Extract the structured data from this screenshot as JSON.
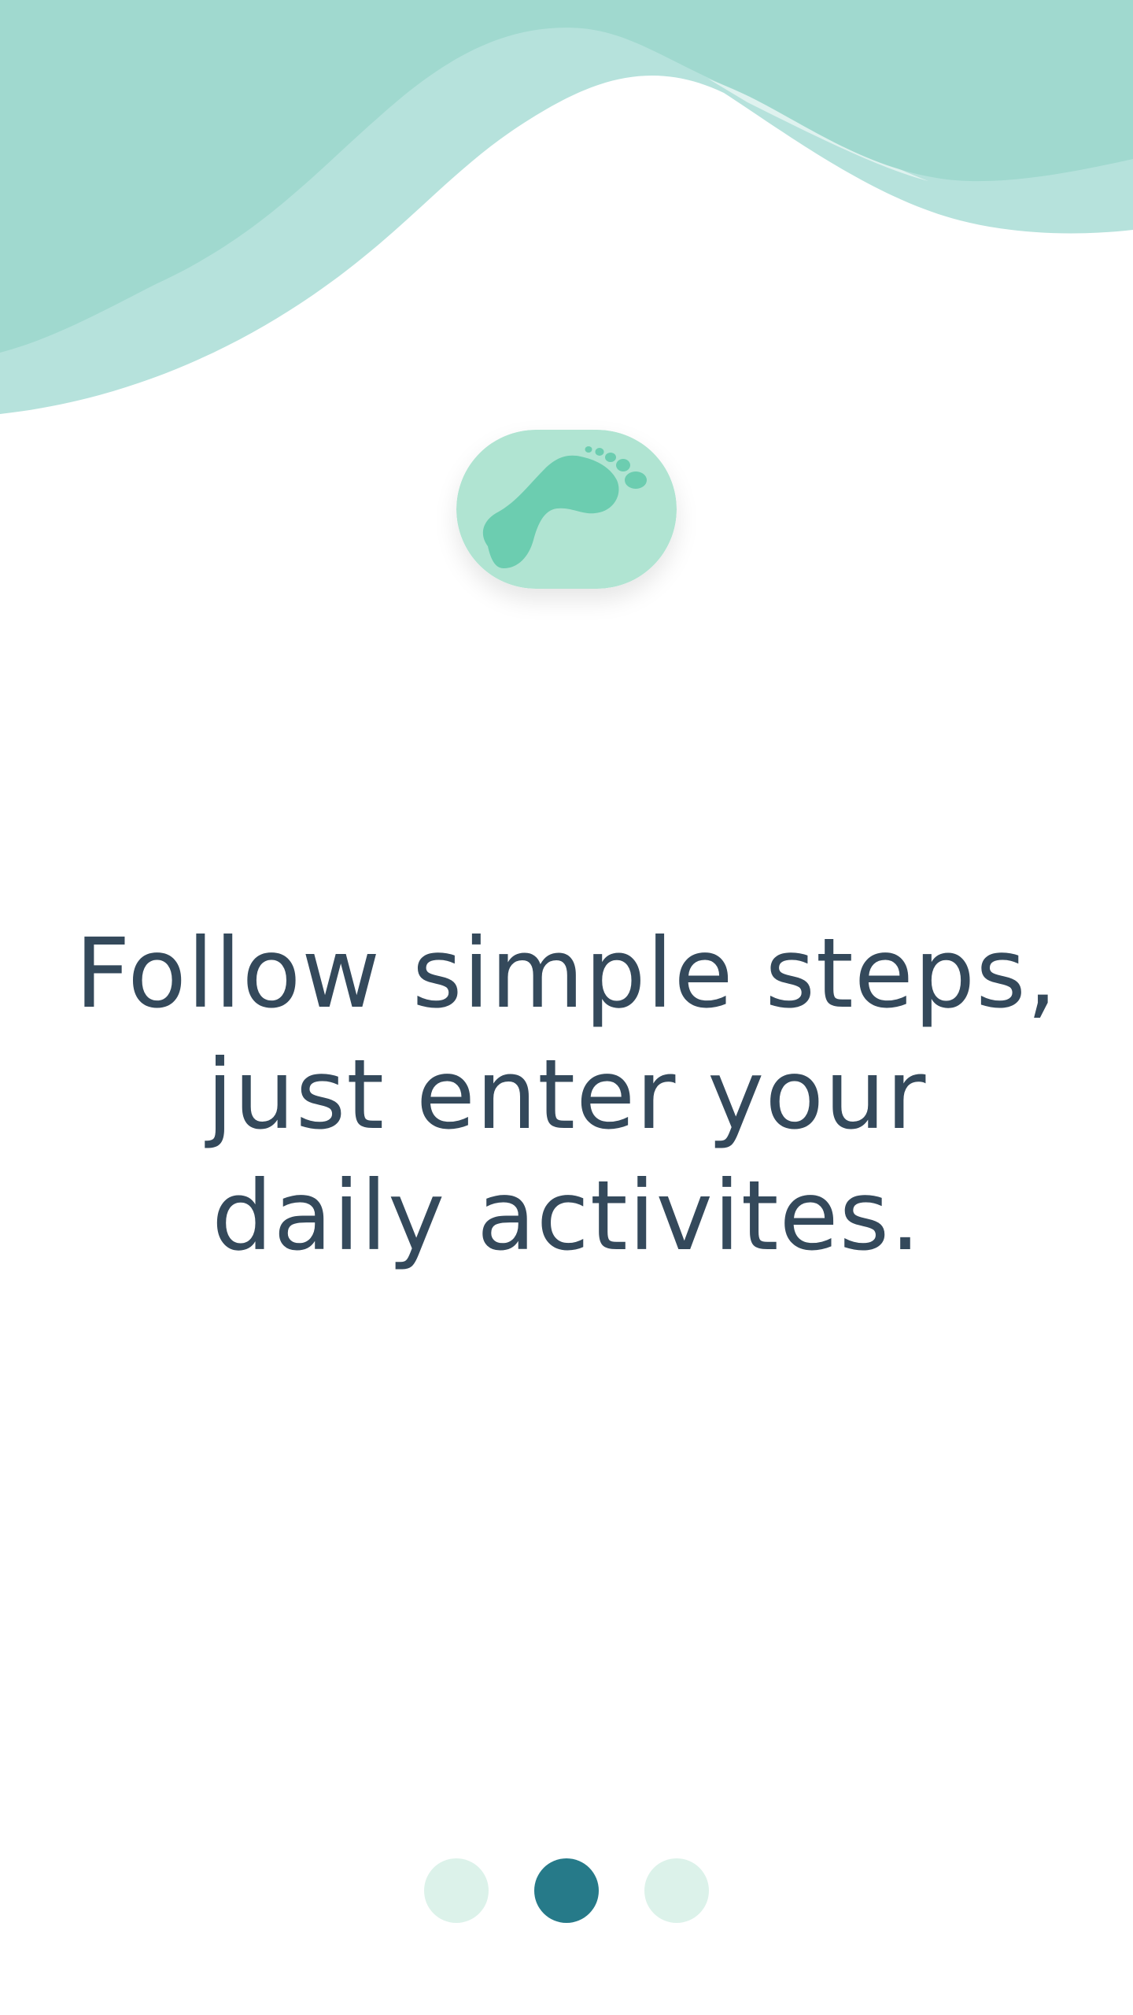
{
  "onboarding": {
    "headline_lines": [
      "Follow simple steps,",
      "just enter your",
      "daily activites."
    ],
    "logo_icon": "footprint-icon",
    "pager": {
      "total_pages": 3,
      "current_page": 2
    }
  },
  "colors": {
    "wave_dark": "#a0d9cf",
    "wave_light": "#b6e2dc",
    "wave_pale": "#dff2ef",
    "badge_background": "#b0e4d2",
    "footprint": "#6ccdb0",
    "headline_text": "#34495b",
    "dot_active": "#267a89",
    "dot_inactive": "#dcf2ea"
  }
}
